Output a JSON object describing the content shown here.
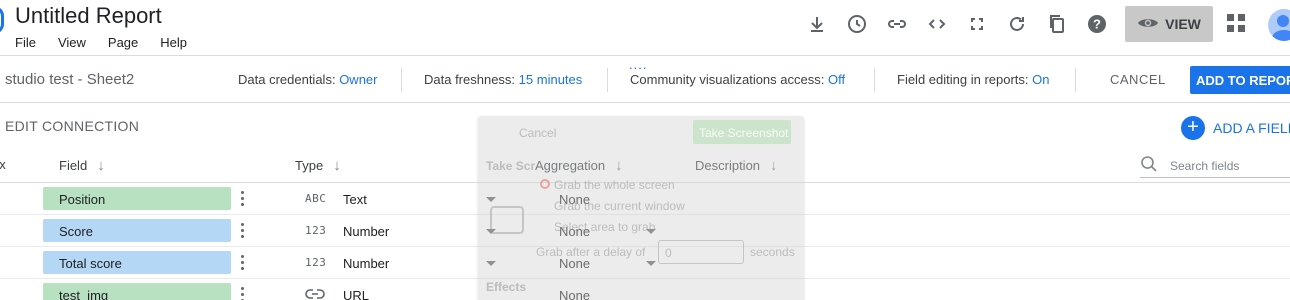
{
  "header": {
    "title": "Untitled Report",
    "menus": [
      "File",
      "View",
      "Page",
      "Help"
    ],
    "view_label": "VIEW",
    "toolbar_icons": [
      "download-icon",
      "history-icon",
      "link-icon",
      "embed-icon",
      "fullscreen-icon",
      "refresh-icon",
      "copy-icon",
      "help-icon"
    ]
  },
  "datasource": {
    "name": "studio test - Sheet2",
    "credentials_label": "Data credentials:",
    "credentials_value": "Owner",
    "freshness_label": "Data freshness:",
    "freshness_value": "15 minutes",
    "community_label": "Community visualizations access:",
    "community_value": "Off",
    "field_editing_label": "Field editing in reports:",
    "field_editing_value": "On",
    "cancel_label": "CANCEL",
    "add_label": "ADD TO REPORT"
  },
  "edit": {
    "title": "EDIT CONNECTION",
    "add_field_label": "ADD A FIELD"
  },
  "table": {
    "columns": {
      "index": "ex",
      "field": "Field",
      "type": "Type",
      "aggregation": "Aggregation",
      "description": "Description"
    },
    "search_placeholder": "Search fields",
    "rows": [
      {
        "field": "Position",
        "kind": "dimension",
        "type_icon": "ABC",
        "type": "Text",
        "aggregation": "None",
        "has_agg_dropdown": false
      },
      {
        "field": "Score",
        "kind": "metric",
        "type_icon": "123",
        "type": "Number",
        "aggregation": "None",
        "has_agg_dropdown": true
      },
      {
        "field": "Total score",
        "kind": "metric",
        "type_icon": "123",
        "type": "Number",
        "aggregation": "None",
        "has_agg_dropdown": true
      },
      {
        "field": "test_img",
        "kind": "dimension",
        "type_icon": "🔗",
        "type": "URL",
        "aggregation": "None",
        "has_agg_dropdown": false
      }
    ]
  },
  "screenshot_dialog": {
    "cancel": "Cancel",
    "take": "Take Screenshot",
    "title": "Take Scr",
    "opt1": "Grab the whole screen",
    "opt2": "Grab the current window",
    "opt3": "Select area to grab",
    "delay": "Grab after a delay of",
    "delay_value": "0",
    "seconds": "seconds",
    "effects": "Effects"
  },
  "colors": {
    "accent": "#1a73e8",
    "dimension_pill": "#b7e1c1",
    "metric_pill": "#b3d7f5"
  }
}
